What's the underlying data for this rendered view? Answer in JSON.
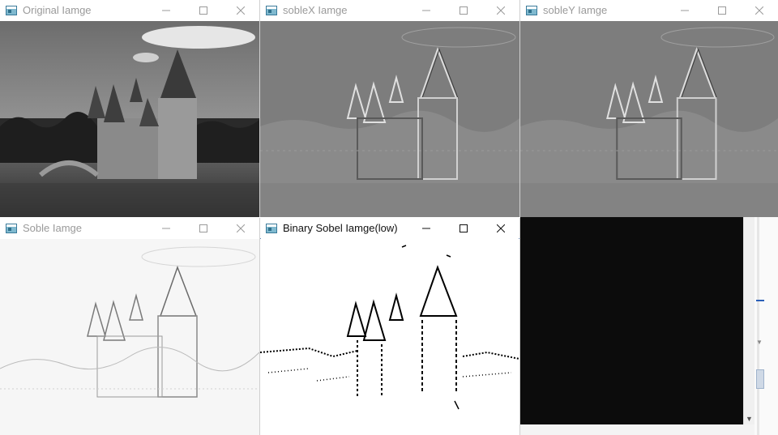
{
  "windows": [
    {
      "id": "original",
      "title": "Original Iamge",
      "active": false
    },
    {
      "id": "sobelx",
      "title": "sobleX Iamge",
      "active": false
    },
    {
      "id": "sobely",
      "title": "sobleY Iamge",
      "active": false
    },
    {
      "id": "soble",
      "title": "Soble Iamge",
      "active": false
    },
    {
      "id": "binary",
      "title": "Binary Sobel Iamge(low)",
      "active": true
    }
  ],
  "icons": {
    "app": "opencv-window-icon",
    "minimize": "minimize-icon",
    "maximize": "maximize-icon",
    "close": "close-icon",
    "scroll_down": "chevron-down-icon"
  },
  "background": {
    "terminal_color": "#0c0c0c"
  }
}
